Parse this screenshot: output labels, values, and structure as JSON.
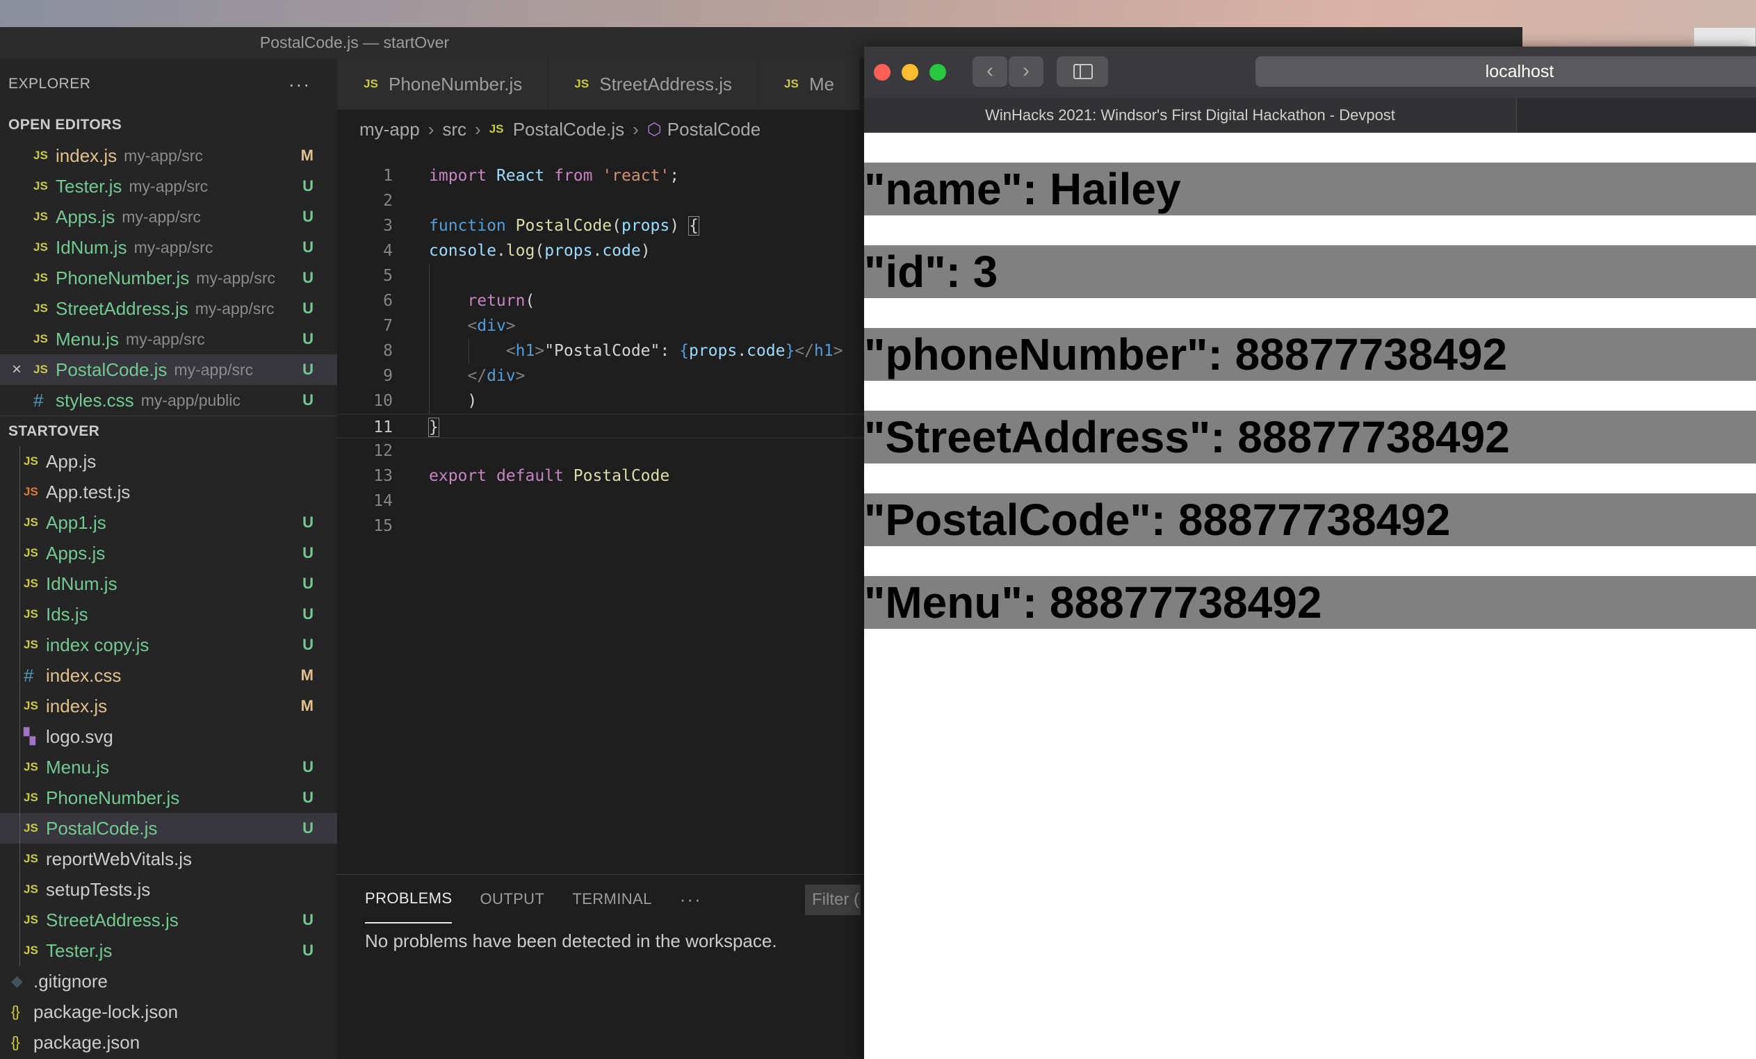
{
  "vscode": {
    "title": "PostalCode.js — startOver",
    "explorer_label": "EXPLORER",
    "explorer_more": "···",
    "open_editors_label": "OPEN EDITORS",
    "open_editors": [
      {
        "name": "index.js",
        "path": "my-app/src",
        "badge": "M",
        "icon": "JS"
      },
      {
        "name": "Tester.js",
        "path": "my-app/src",
        "badge": "U",
        "icon": "JS"
      },
      {
        "name": "Apps.js",
        "path": "my-app/src",
        "badge": "U",
        "icon": "JS"
      },
      {
        "name": "IdNum.js",
        "path": "my-app/src",
        "badge": "U",
        "icon": "JS"
      },
      {
        "name": "PhoneNumber.js",
        "path": "my-app/src",
        "badge": "U",
        "icon": "JS"
      },
      {
        "name": "StreetAddress.js",
        "path": "my-app/src",
        "badge": "U",
        "icon": "JS"
      },
      {
        "name": "Menu.js",
        "path": "my-app/src",
        "badge": "U",
        "icon": "JS"
      },
      {
        "name": "PostalCode.js",
        "path": "my-app/src",
        "badge": "U",
        "icon": "JS",
        "close": "×"
      },
      {
        "name": "styles.css",
        "path": "my-app/public",
        "badge": "U",
        "icon": "#"
      }
    ],
    "project_label": "STARTOVER",
    "files": [
      {
        "name": "App.js",
        "badge": "",
        "icon": "JS"
      },
      {
        "name": "App.test.js",
        "badge": "",
        "icon": "JS"
      },
      {
        "name": "App1.js",
        "badge": "U",
        "icon": "JS"
      },
      {
        "name": "Apps.js",
        "badge": "U",
        "icon": "JS"
      },
      {
        "name": "IdNum.js",
        "badge": "U",
        "icon": "JS"
      },
      {
        "name": "Ids.js",
        "badge": "U",
        "icon": "JS"
      },
      {
        "name": "index copy.js",
        "badge": "U",
        "icon": "JS"
      },
      {
        "name": "index.css",
        "badge": "M",
        "icon": "#"
      },
      {
        "name": "index.js",
        "badge": "M",
        "icon": "JS"
      },
      {
        "name": "logo.svg",
        "badge": "",
        "icon": "svg"
      },
      {
        "name": "Menu.js",
        "badge": "U",
        "icon": "JS"
      },
      {
        "name": "PhoneNumber.js",
        "badge": "U",
        "icon": "JS"
      },
      {
        "name": "PostalCode.js",
        "badge": "U",
        "icon": "JS"
      },
      {
        "name": "reportWebVitals.js",
        "badge": "",
        "icon": "JS"
      },
      {
        "name": "setupTests.js",
        "badge": "",
        "icon": "JS"
      },
      {
        "name": "StreetAddress.js",
        "badge": "U",
        "icon": "JS"
      },
      {
        "name": "Tester.js",
        "badge": "U",
        "icon": "JS"
      }
    ],
    "root_files": [
      {
        "name": ".gitignore",
        "icon": "◆"
      },
      {
        "name": "package-lock.json",
        "icon": "{}"
      },
      {
        "name": "package.json",
        "icon": "{}"
      }
    ],
    "tabs": [
      {
        "label": "PhoneNumber.js",
        "icon": "JS"
      },
      {
        "label": "StreetAddress.js",
        "icon": "JS"
      },
      {
        "label": "Me",
        "icon": "JS"
      }
    ],
    "breadcrumb": {
      "parts": [
        "my-app",
        "src"
      ],
      "file": "PostalCode.js",
      "file_icon": "JS",
      "symbol": "PostalCode"
    },
    "line_numbers": [
      "1",
      "2",
      "3",
      "4",
      "5",
      "6",
      "7",
      "8",
      "9",
      "10",
      "11",
      "12",
      "13",
      "14",
      "15"
    ],
    "panel": {
      "tabs": [
        "PROBLEMS",
        "OUTPUT",
        "TERMINAL"
      ],
      "more": "···",
      "filter_placeholder": "Filter (",
      "message": "No problems have been detected in the workspace."
    },
    "colors": {
      "modified": "#e2c08d",
      "untracked": "#73c991",
      "editor_bg": "#1e1e1e",
      "sidebar_bg": "#252526"
    }
  },
  "browser": {
    "address": "localhost",
    "tab_title": "WinHacks 2021: Windsor's First Digital Hackathon - Devpost",
    "back_icon": "‹",
    "forward_icon": "›",
    "headings": [
      "\"name\": Hailey",
      "\"id\": 3",
      "\"phoneNumber\": 88877738492",
      "\"StreetAddress\": 88877738492",
      "\"PostalCode\": 88877738492",
      "\"Menu\": 88877738492"
    ],
    "colors": {
      "heading_bg": "#808080",
      "close": "#ff5f57",
      "minimize": "#febc2e",
      "zoom": "#28c840"
    }
  }
}
